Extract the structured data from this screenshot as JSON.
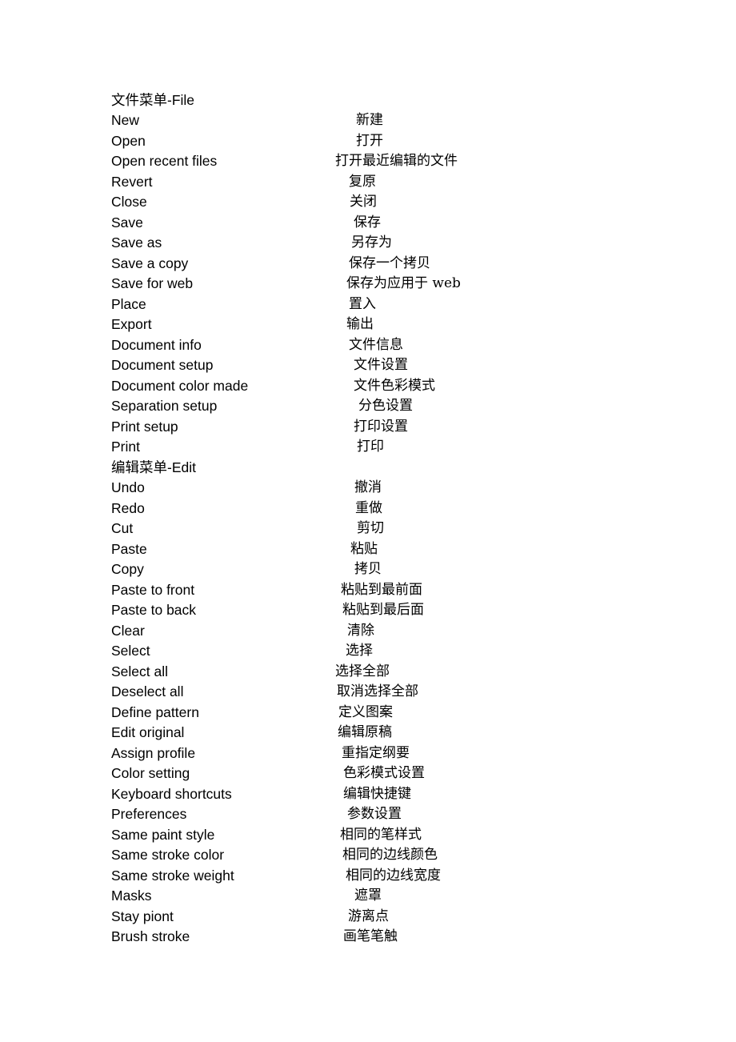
{
  "sections": [
    {
      "heading": "文件菜单-File",
      "items": [
        {
          "en": "New",
          "zh": "新建"
        },
        {
          "en": "Open",
          "zh": "打开"
        },
        {
          "en": "Open recent files",
          "zh": "打开最近编辑的文件"
        },
        {
          "en": "Revert",
          "zh": "复原"
        },
        {
          "en": "Close",
          "zh": "关闭"
        },
        {
          "en": "Save",
          "zh": "保存"
        },
        {
          "en": "Save as",
          "zh": "另存为"
        },
        {
          "en": "Save a copy",
          "zh": "保存一个拷贝"
        },
        {
          "en": "Save for web",
          "zh": "保存为应用于 web"
        },
        {
          "en": "Place",
          "zh": "置入"
        },
        {
          "en": "Export",
          "zh": "输出"
        },
        {
          "en": "Document info",
          "zh": "文件信息"
        },
        {
          "en": "Document setup",
          "zh": "文件设置"
        },
        {
          "en": "Document color made",
          "zh": "文件色彩模式"
        },
        {
          "en": "Separation setup",
          "zh": "分色设置"
        },
        {
          "en": "Print setup",
          "zh": "打印设置"
        },
        {
          "en": "Print",
          "zh": "打印"
        }
      ]
    },
    {
      "heading": "编辑菜单-Edit",
      "items": [
        {
          "en": "Undo",
          "zh": "撤消"
        },
        {
          "en": "Redo",
          "zh": "重做"
        },
        {
          "en": "Cut",
          "zh": "剪切"
        },
        {
          "en": "Paste",
          "zh": "粘贴"
        },
        {
          "en": "Copy",
          "zh": "拷贝"
        },
        {
          "en": "Paste to front",
          "zh": "粘贴到最前面"
        },
        {
          "en": "Paste to back",
          "zh": "粘贴到最后面"
        },
        {
          "en": "Clear",
          "zh": "清除"
        },
        {
          "en": "Select",
          "zh": "选择"
        },
        {
          "en": "Select all",
          "zh": "选择全部"
        },
        {
          "en": "Deselect all",
          "zh": "取消选择全部"
        },
        {
          "en": "Define pattern",
          "zh": "定义图案"
        },
        {
          "en": "Edit original",
          "zh": "编辑原稿"
        },
        {
          "en": "Assign profile",
          "zh": "重指定纲要"
        },
        {
          "en": "Color setting",
          "zh": "色彩模式设置"
        },
        {
          "en": "Keyboard shortcuts",
          "zh": "编辑快捷键"
        },
        {
          "en": "Preferences",
          "zh": "参数设置"
        },
        {
          "en": "Same paint style",
          "zh": "相同的笔样式"
        },
        {
          "en": "Same stroke color",
          "zh": "相同的边线颜色"
        },
        {
          "en": "Same stroke weight",
          "zh": "相同的边线宽度"
        },
        {
          "en": "Masks",
          "zh": "遮罩"
        },
        {
          "en": "Stay piont",
          "zh": "游离点"
        },
        {
          "en": "Brush stroke",
          "zh": "画笔笔触"
        }
      ]
    }
  ]
}
